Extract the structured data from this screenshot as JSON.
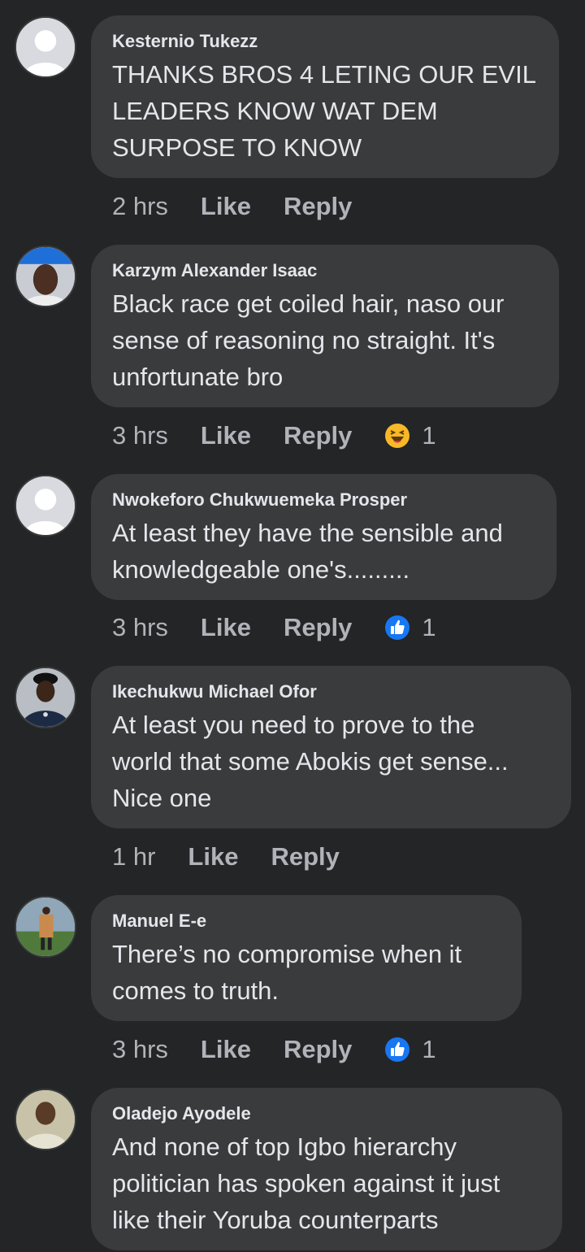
{
  "comments": [
    {
      "author": "Kesternio Tukezz",
      "text": "THANKS BROS 4 LETING OUR EVIL\nLEADERS KNOW WAT DEM\nSURPOSE TO KNOW",
      "time": "2 hrs",
      "like_label": "Like",
      "reply_label": "Reply",
      "reaction": null,
      "avatar": "default-avatar"
    },
    {
      "author": "Karzym Alexander Isaac",
      "text": "Black race get coiled hair, naso our\nsense of reasoning no straight. It's\nunfortunate bro",
      "time": "3 hrs",
      "like_label": "Like",
      "reply_label": "Reply",
      "reaction": {
        "type": "haha-icon",
        "count": "1"
      },
      "avatar": "photo-avatar"
    },
    {
      "author": "Nwokeforo Chukwuemeka Prosper",
      "text": "At least they have the sensible and\nknowledgeable one's.........",
      "time": "3 hrs",
      "like_label": "Like",
      "reply_label": "Reply",
      "reaction": {
        "type": "like-reaction-icon",
        "count": "1"
      },
      "avatar": "default-avatar"
    },
    {
      "author": "Ikechukwu Michael Ofor",
      "text": "At least you need to prove to the\nworld that some Abokis get sense...\nNice one",
      "time": "1 hr",
      "like_label": "Like",
      "reply_label": "Reply",
      "reaction": null,
      "avatar": "photo-avatar"
    },
    {
      "author": "Manuel E-e",
      "text": "There’s no compromise when it\ncomes to truth.",
      "time": "3 hrs",
      "like_label": "Like",
      "reply_label": "Reply",
      "reaction": {
        "type": "like-reaction-icon",
        "count": "1"
      },
      "avatar": "photo-avatar"
    },
    {
      "author": "Oladejo Ayodele",
      "text": "And none of top Igbo hierarchy\npolitician has spoken against it just\nlike their Yoruba counterparts",
      "time": "",
      "like_label": "",
      "reply_label": "",
      "reaction": null,
      "avatar": "photo-avatar"
    }
  ],
  "colors": {
    "background": "#242527",
    "bubble": "#3a3b3c",
    "text": "#e4e6eb",
    "secondary": "#b0b3b8",
    "like_blue": "#1877f2",
    "haha_yellow": "#f7b928"
  }
}
